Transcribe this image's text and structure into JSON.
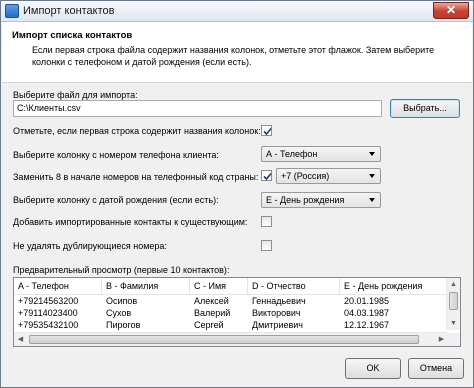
{
  "window": {
    "title": "Импорт контактов",
    "close_label": "✕"
  },
  "header": {
    "title": "Импорт списка контактов",
    "description": "Если первая строка файла содержит названия колонок, отметьте этот флажок. Затем выберите колонки с телефоном и датой рождения (если есть)."
  },
  "file": {
    "label": "Выберите файл для импорта:",
    "value": "C:\\Клиенты.csv",
    "browse_label": "Выбрать..."
  },
  "options": {
    "first_row_label": "Отметьте, если первая строка содержит названия колонок:",
    "first_row_checked": true,
    "phone_col_label": "Выберите колонку с номером телефона клиента:",
    "phone_col_value": "А - Телефон",
    "replace_code_label": "Заменить 8 в начале номеров на телефонный код страны:",
    "replace_code_checked": true,
    "country_code_value": "+7 (Россия)",
    "birthday_col_label": "Выберите колонку с датой рождения (если есть):",
    "birthday_col_value": "Е - День рождения",
    "add_existing_label": "Добавить импортированные контакты к существующим:",
    "add_existing_checked": false,
    "keep_duplicates_label": "Не удалять дублирующиеся номера:",
    "keep_duplicates_checked": false
  },
  "preview": {
    "label": "Предварительный просмотр (первые 10 контактов):",
    "columns": [
      "A - Телефон",
      "B - Фамилия",
      "C - Имя",
      "D - Отчество",
      "E - День рождения"
    ],
    "rows": [
      [
        "+79214563200",
        "Осипов",
        "Алексей",
        "Геннадьевич",
        "20.01.1985"
      ],
      [
        "+79114023400",
        "Сухов",
        "Валерий",
        "Викторович",
        "04.03.1987"
      ],
      [
        "+79535432100",
        "Пирогов",
        "Сергей",
        "Дмитриевич",
        "12.12.1967"
      ],
      [
        "",
        "",
        "",
        "",
        ""
      ]
    ]
  },
  "footer": {
    "ok_label": "OK",
    "cancel_label": "Отмена"
  }
}
